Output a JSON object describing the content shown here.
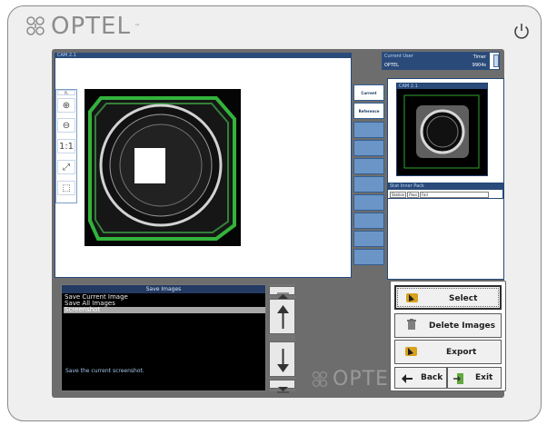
{
  "brand": {
    "name": "OPTEL",
    "trademark": "™"
  },
  "camera": {
    "title": "CAM 2.1",
    "tools": {
      "small_label": "PL",
      "zoom_in": "⊕",
      "zoom_out": "⊖",
      "actual_size": "1:1",
      "fit_screen": "⤢",
      "crop": "⬚"
    }
  },
  "tabs": [
    "Current",
    "Reference"
  ],
  "user": {
    "current_user_label": "Current User",
    "current_user": "OPTEL",
    "timer_label": "Timer",
    "timer_value": "9904s"
  },
  "thumbnail": {
    "title": "CAM 2.1"
  },
  "stat": {
    "title": "Stat Inner Pack",
    "columns": [
      "Station",
      "Pass",
      "Fail"
    ]
  },
  "save_images": {
    "title": "Save Images",
    "items": [
      "Save Current Image",
      "Save All Images",
      "Screenshot"
    ],
    "selected_index": 2,
    "helper": "Save the current screenshot."
  },
  "actions": {
    "select": "Select",
    "delete": "Delete Images",
    "export": "Export",
    "back": "Back",
    "exit": "Exit"
  },
  "colors": {
    "panel_blue": "#2a4a7a",
    "tab_blue": "#6a95c6",
    "green_frame": "#2fa52f"
  }
}
